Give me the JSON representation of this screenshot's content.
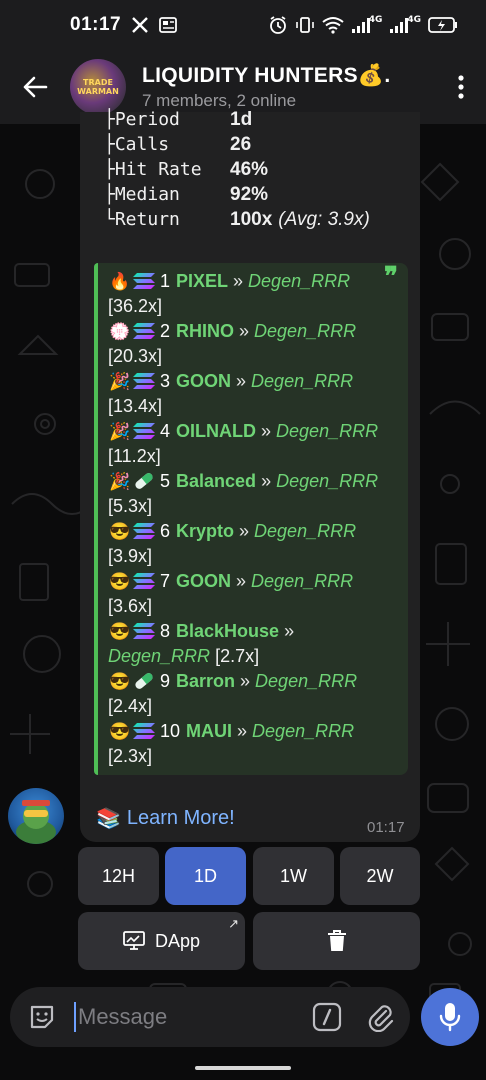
{
  "status_bar": {
    "time": "01:17",
    "network_1": "4G",
    "network_2": "4G"
  },
  "header": {
    "title": "LIQUIDITY HUNTERS💰.",
    "subtitle": "7 members, 2 online",
    "avatar_text": "TRADE WARMAN"
  },
  "stats": [
    {
      "key": "Period",
      "value": "1d",
      "avg": ""
    },
    {
      "key": "Calls",
      "value": "26",
      "avg": ""
    },
    {
      "key": "Hit Rate",
      "value": "46%",
      "avg": ""
    },
    {
      "key": "Median",
      "value": "92%",
      "avg": ""
    },
    {
      "key": "Return",
      "value": "100x",
      "avg": "(Avg: 3.9x)"
    }
  ],
  "stat_prefixes": [
    "├",
    "├",
    "├",
    "├",
    "└"
  ],
  "leaderboard": [
    {
      "emoji": "🔥",
      "chain": "sol",
      "rank": "1",
      "token": "PIXEL",
      "sep": " » ",
      "caller": "Degen_RRR",
      "mult": "[36.2x]"
    },
    {
      "emoji": "💮",
      "chain": "sol",
      "rank": "2",
      "token": "RHINO",
      "sep": " » ",
      "caller": "Degen_RRR",
      "mult": "[20.3x]"
    },
    {
      "emoji": "🎉",
      "chain": "sol",
      "rank": "3",
      "token": "GOON",
      "sep": " » ",
      "caller": "Degen_RRR",
      "mult": "[13.4x]"
    },
    {
      "emoji": "🎉",
      "chain": "sol",
      "rank": "4",
      "token": "OILNALD",
      "sep": " » ",
      "caller": "Degen_RRR",
      "mult": "[11.2x]"
    },
    {
      "emoji": "🎉",
      "chain": "pill",
      "rank": "5",
      "token": "Balanced",
      "sep": " » ",
      "caller": "Degen_RRR",
      "mult": "[5.3x]"
    },
    {
      "emoji": "😎",
      "chain": "sol",
      "rank": "6",
      "token": "Krypto ",
      "sep": " » ",
      "caller": "Degen_RRR",
      "mult": "[3.9x]"
    },
    {
      "emoji": "😎",
      "chain": "sol",
      "rank": "7",
      "token": "GOON",
      "sep": " » ",
      "caller": "Degen_RRR",
      "mult": "[3.6x]"
    },
    {
      "emoji": "😎",
      "chain": "sol",
      "rank": "8",
      "token": "BlackHouse",
      "sep": " » ",
      "caller": "Degen_RRR",
      "mult": "[2.7x]"
    },
    {
      "emoji": "😎",
      "chain": "pill",
      "rank": "9",
      "token": "Barron",
      "sep": " » ",
      "caller": "Degen_RRR",
      "mult": "[2.4x]"
    },
    {
      "emoji": "😎",
      "chain": "sol",
      "rank": "10",
      "token": "MAUI",
      "sep": " » ",
      "caller": "Degen_RRR",
      "mult": "[2.3x]"
    }
  ],
  "quote_mark": "❞",
  "learn_more": {
    "emoji": "📚",
    "label": "Learn More!"
  },
  "message_time": "01:17",
  "keyboard": {
    "periods": [
      {
        "label": "12H",
        "active": false
      },
      {
        "label": "1D",
        "active": true
      },
      {
        "label": "1W",
        "active": false
      },
      {
        "label": "2W",
        "active": false
      }
    ],
    "dapp_label": "DApp",
    "dapp_corner": "↗"
  },
  "composer": {
    "placeholder": "Message"
  },
  "colors": {
    "accent_green": "#6fd476",
    "link_blue": "#7fb4ff",
    "active_button": "#4466c8",
    "mic": "#4d73d8"
  }
}
